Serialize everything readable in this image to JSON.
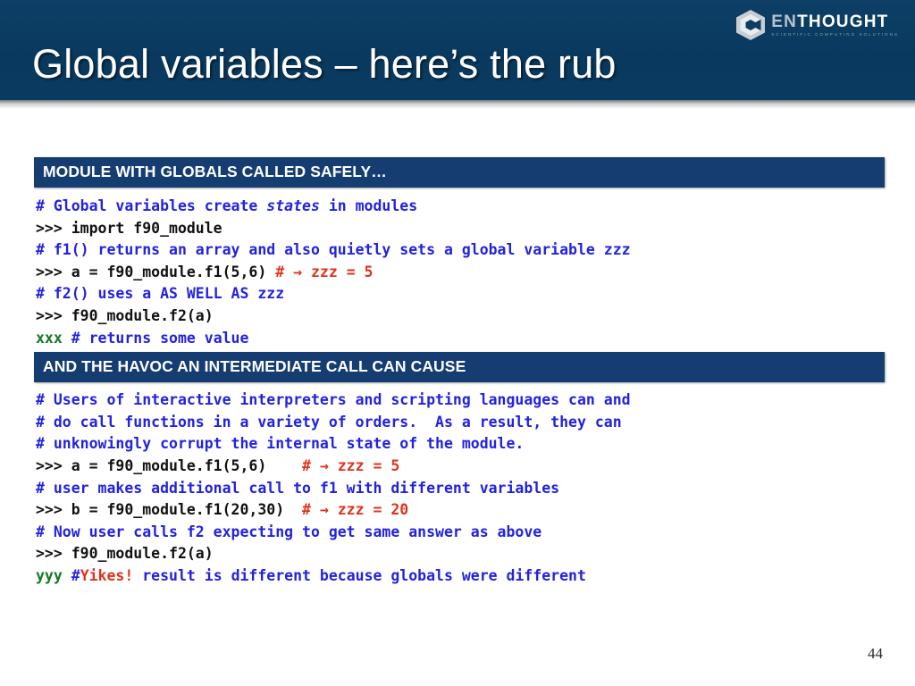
{
  "slide": {
    "title": "Global variables – here’s the rub",
    "page_number": "44",
    "banner_color": "#0a3c63",
    "section_header_color": "#153d72"
  },
  "logo": {
    "name": "enthought-logo",
    "word_en": "EN",
    "word_rest": "THOUGHT",
    "tagline": "SCIENTIFIC COMPUTING SOLUTIONS"
  },
  "sections": [
    {
      "header": "MODULE WITH GLOBALS CALLED SAFELY…",
      "lines": [
        {
          "id": "s1-l1",
          "spans": [
            {
              "text": "# Global variables create ",
              "style": "comment"
            },
            {
              "text": "states",
              "style": "comment-italic"
            },
            {
              "text": " in modules",
              "style": "comment"
            }
          ]
        },
        {
          "id": "s1-l2",
          "spans": [
            {
              "text": ">>> import f90_module",
              "style": "code"
            }
          ]
        },
        {
          "id": "s1-l3",
          "spans": [
            {
              "text": "# f1() returns an array and also quietly sets a global variable zzz",
              "style": "comment"
            }
          ]
        },
        {
          "id": "s1-l4",
          "spans": [
            {
              "text": ">>> a = f90_module.f1(5,6) ",
              "style": "code"
            },
            {
              "text": "# → zzz = 5",
              "style": "note"
            }
          ]
        },
        {
          "id": "s1-l5",
          "spans": [
            {
              "text": "# f2() uses a AS WELL AS zzz",
              "style": "comment"
            }
          ]
        },
        {
          "id": "s1-l6",
          "spans": [
            {
              "text": ">>> f90_module.f2(a)",
              "style": "code"
            }
          ]
        },
        {
          "id": "s1-l7",
          "spans": [
            {
              "text": "xxx",
              "style": "output"
            },
            {
              "text": " # returns some value",
              "style": "comment"
            }
          ]
        }
      ]
    },
    {
      "header": "AND THE HAVOC AN INTERMEDIATE CALL CAN CAUSE",
      "lines": [
        {
          "id": "s2-l1",
          "spans": [
            {
              "text": "# Users of interactive interpreters and scripting languages can and",
              "style": "comment"
            }
          ]
        },
        {
          "id": "s2-l2",
          "spans": [
            {
              "text": "# do call functions in a variety of orders.  As a result, they can",
              "style": "comment"
            }
          ]
        },
        {
          "id": "s2-l3",
          "spans": [
            {
              "text": "# unknowingly corrupt the internal state of the module.",
              "style": "comment"
            }
          ]
        },
        {
          "id": "s2-l4",
          "spans": [
            {
              "text": ">>> a = f90_module.f1(5,6)    ",
              "style": "code"
            },
            {
              "text": "# → zzz = 5",
              "style": "note"
            }
          ]
        },
        {
          "id": "s2-l5",
          "spans": [
            {
              "text": "# user makes additional call to f1 with different variables",
              "style": "comment"
            }
          ]
        },
        {
          "id": "s2-l6",
          "spans": [
            {
              "text": ">>> b = f90_module.f1(20,30)  ",
              "style": "code"
            },
            {
              "text": "# → zzz = 20",
              "style": "note"
            }
          ]
        },
        {
          "id": "s2-l7",
          "spans": [
            {
              "text": "# Now user calls f2 expecting to get same answer as above",
              "style": "comment"
            }
          ]
        },
        {
          "id": "s2-l8",
          "spans": [
            {
              "text": ">>> f90_module.f2(a)",
              "style": "code"
            }
          ]
        },
        {
          "id": "s2-l9",
          "spans": [
            {
              "text": "yyy ",
              "style": "output"
            },
            {
              "text": "#",
              "style": "comment"
            },
            {
              "text": "Yikes!",
              "style": "note"
            },
            {
              "text": " result is different because globals were different",
              "style": "comment"
            }
          ]
        }
      ]
    }
  ]
}
